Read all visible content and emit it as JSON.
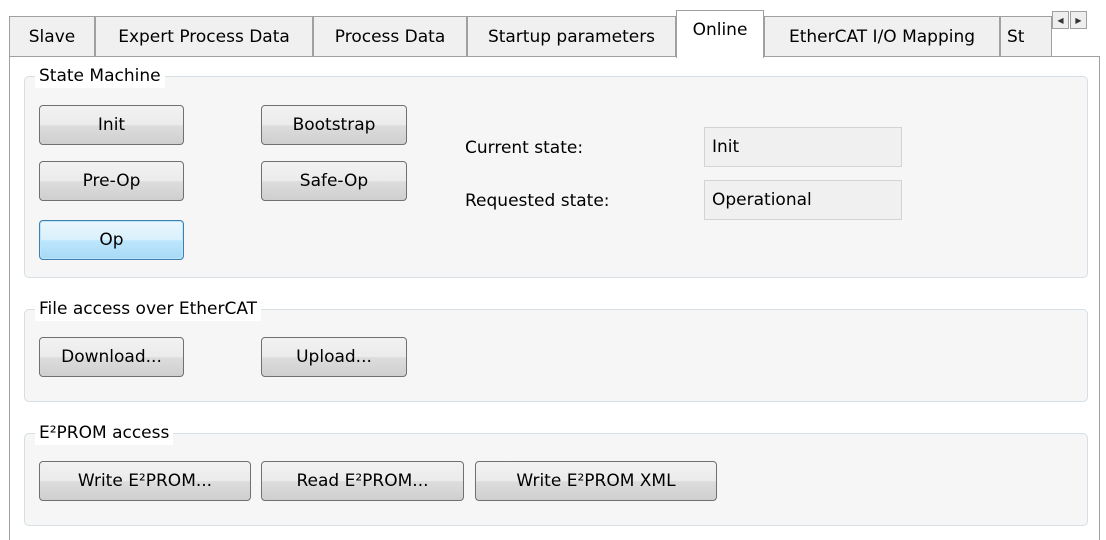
{
  "tabs": [
    {
      "label": "Slave"
    },
    {
      "label": "Expert Process Data"
    },
    {
      "label": "Process Data"
    },
    {
      "label": "Startup parameters"
    },
    {
      "label": "Online"
    },
    {
      "label": "EtherCAT I/O Mapping"
    },
    {
      "label": "St"
    }
  ],
  "tab_scroll": {
    "left_icon": "arrow-left-icon",
    "right_icon": "arrow-right-icon"
  },
  "state_machine": {
    "title": "State Machine",
    "buttons": {
      "init": "Init",
      "bootstrap": "Bootstrap",
      "pre_op": "Pre-Op",
      "safe_op": "Safe-Op",
      "op": "Op"
    },
    "current_state_label": "Current state:",
    "current_state_value": "Init",
    "requested_state_label": "Requested state:",
    "requested_state_value": "Operational"
  },
  "file_access": {
    "title": "File access over EtherCAT",
    "download": "Download...",
    "upload": "Upload..."
  },
  "eeprom": {
    "title": "E²PROM access",
    "write": "Write E²PROM...",
    "read": "Read E²PROM...",
    "write_xml": "Write E²PROM XML"
  },
  "colors": {
    "group_border": "#d5dfe5",
    "focus_border": "#3c7fb1"
  }
}
